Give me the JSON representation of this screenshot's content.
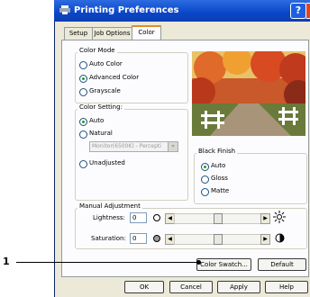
{
  "window": {
    "title": "Printing Preferences",
    "help": "?"
  },
  "tabs": [
    {
      "label": "Setup"
    },
    {
      "label": "Job Options"
    },
    {
      "label": "Color"
    }
  ],
  "color_mode": {
    "label": "Color Mode",
    "options": [
      {
        "label": "Auto Color",
        "selected": false
      },
      {
        "label": "Advanced Color",
        "selected": true
      },
      {
        "label": "Grayscale",
        "selected": false
      }
    ]
  },
  "color_setting": {
    "label": "Color Setting:",
    "options": [
      {
        "label": "Auto",
        "selected": true
      },
      {
        "label": "Natural",
        "selected": false
      },
      {
        "label": "Unadjusted",
        "selected": false
      }
    ],
    "monitor_select": "Monitor(6500K) - Percepti"
  },
  "black_finish": {
    "label": "Black Finish",
    "options": [
      {
        "label": "Auto",
        "selected": true
      },
      {
        "label": "Gloss",
        "selected": false
      },
      {
        "label": "Matte",
        "selected": false
      }
    ]
  },
  "manual_adjustment": {
    "label": "Manual Adjustment",
    "lightness": {
      "label": "Lightness:",
      "value": "0",
      "level": 0.5
    },
    "saturation": {
      "label": "Saturation:",
      "value": "0",
      "level": 0.5
    }
  },
  "buttons": {
    "color_swatch": "Color Swatch...",
    "default": "Default",
    "ok": "OK",
    "cancel": "Cancel",
    "apply": "Apply",
    "help": "Help"
  },
  "callout": {
    "number": "1"
  }
}
